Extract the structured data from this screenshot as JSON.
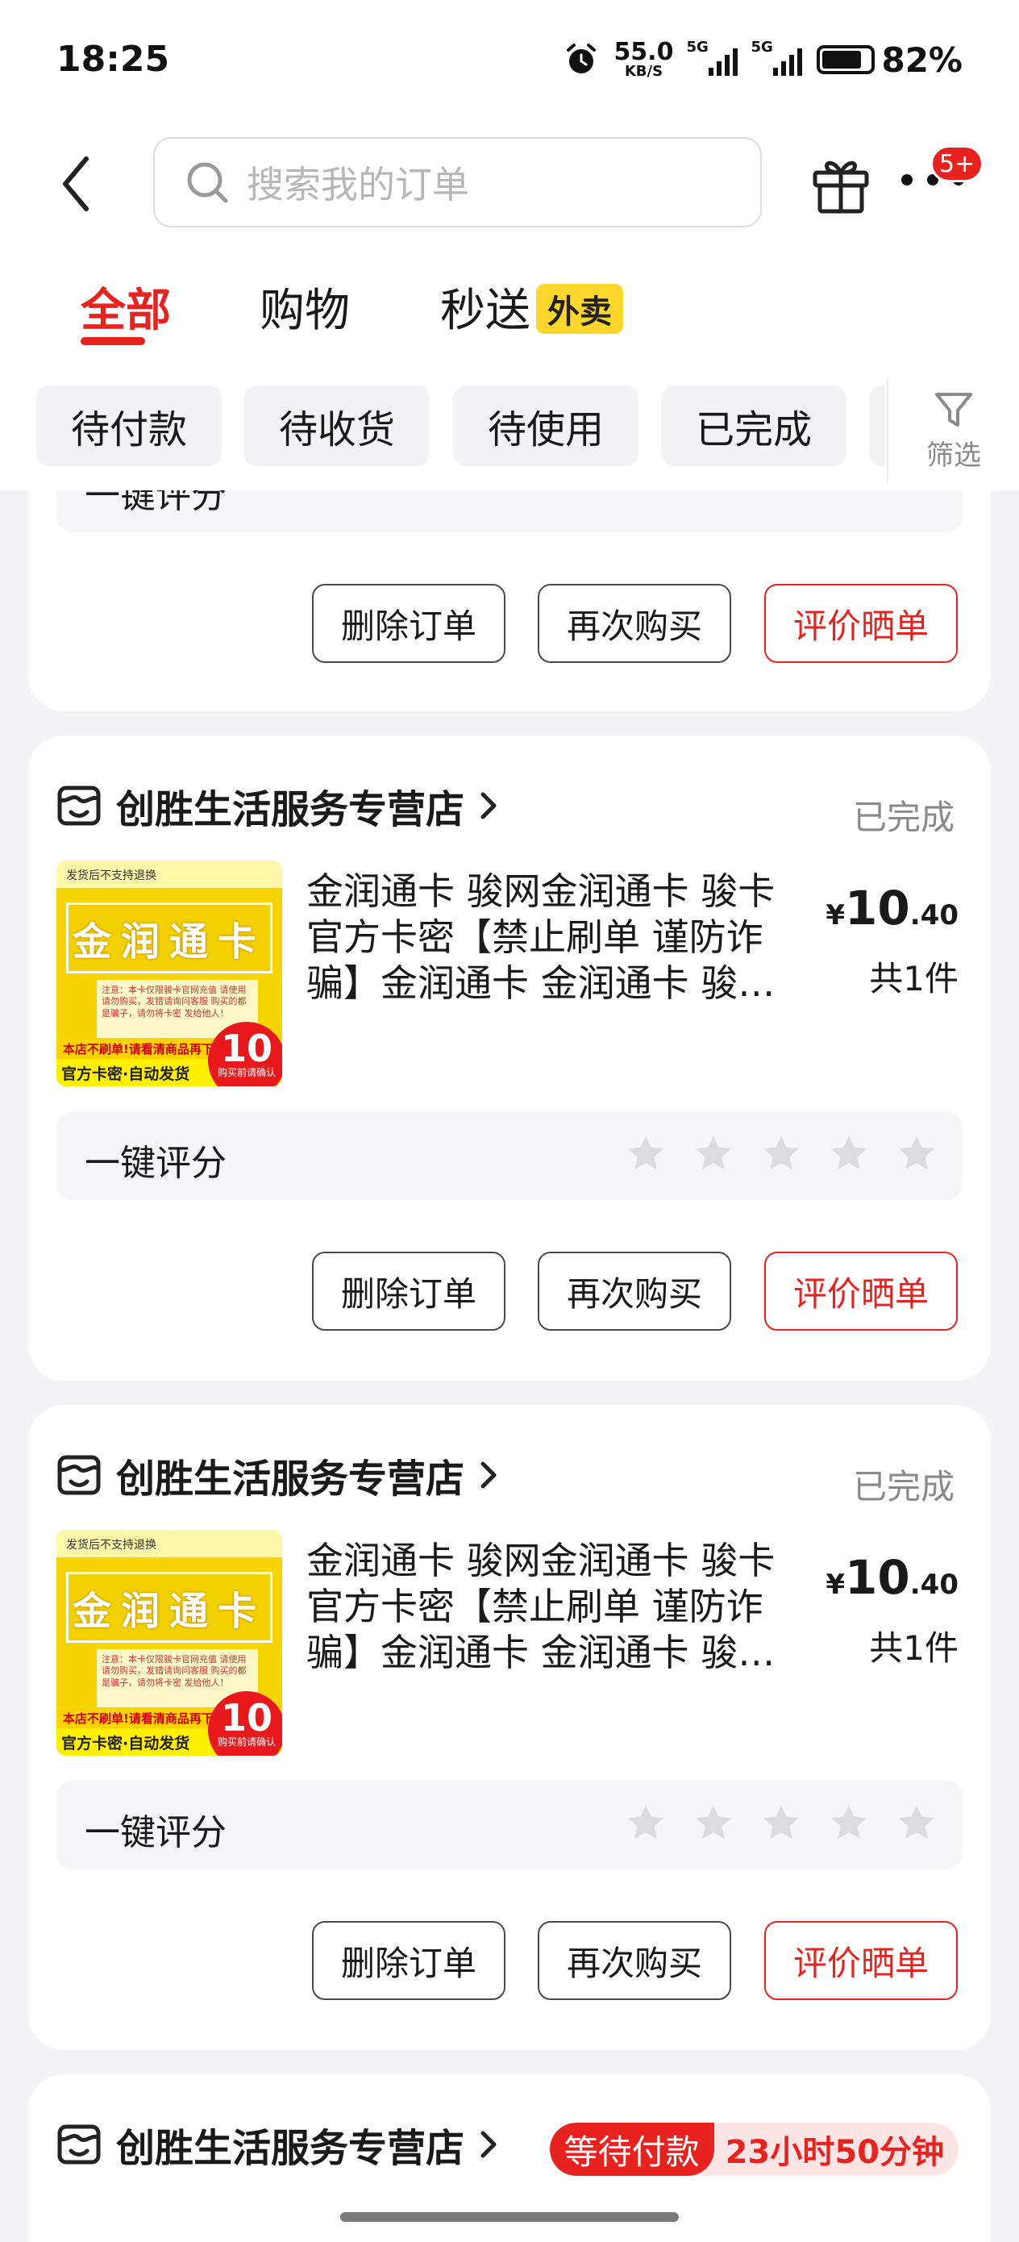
{
  "status_bar": {
    "time": "18:25",
    "net_speed_value": "55.0",
    "net_speed_unit": "KB/S",
    "signal1_label": "5G",
    "signal2_label": "5G",
    "battery": "82%",
    "battery_level": 0.82
  },
  "header": {
    "search_placeholder": "搜索我的订单",
    "more_badge": "5+"
  },
  "main_tabs": [
    {
      "label": "全部",
      "active": true
    },
    {
      "label": "购物",
      "active": false
    },
    {
      "label": "秒送",
      "active": false
    }
  ],
  "takeout_tag": "外卖",
  "sub_tabs": [
    "待付款",
    "待收货",
    "待使用",
    "已完成"
  ],
  "filter_label": "筛选",
  "partial_review_label": "一键评分",
  "orders": [
    {
      "store": "创胜生活服务专营店",
      "status": "已完成",
      "product_title": "金润通卡 骏网金润通卡 骏卡官方卡密【禁止刷单 谨防诈骗】金润通卡 金润通卡 骏网金润通卡",
      "price_currency": "¥",
      "price_int": "10",
      "price_dec": ".40",
      "qty": "共1件",
      "review_label": "一键评分",
      "buttons": [
        "删除订单",
        "再次购买",
        "评价晒单"
      ]
    },
    {
      "store": "创胜生活服务专营店",
      "status": "已完成",
      "product_title": "金润通卡 骏网金润通卡 骏卡官方卡密【禁止刷单 谨防诈骗】金润通卡 金润通卡 骏网金润通卡",
      "price_currency": "¥",
      "price_int": "10",
      "price_dec": ".40",
      "qty": "共1件",
      "review_label": "一键评分",
      "buttons": [
        "删除订单",
        "再次购买",
        "评价晒单"
      ]
    },
    {
      "store": "创胜生活服务专营店",
      "pay_status": "等待付款",
      "pay_countdown": "23小时50分钟"
    }
  ],
  "top_card_buttons": [
    "删除订单",
    "再次购买",
    "评价晒单"
  ],
  "product_image": {
    "top_note": "发货后不支持退换",
    "title": "金润通卡",
    "note": "注意：本卡仅限骏卡官网充值 请使用请勿购买，发错请询问客服 购买的都是骗子，请勿将卡密 发给他人！",
    "strip": "本店不刷单!请看清商品再下单!",
    "bottom": "官方卡密·自动发货",
    "circle_num": "10",
    "circle_sub": "购买前请确认"
  },
  "colors": {
    "accent": "#e8231f",
    "background": "#f4f4f6",
    "takeout_yellow": "#ffd72c"
  }
}
